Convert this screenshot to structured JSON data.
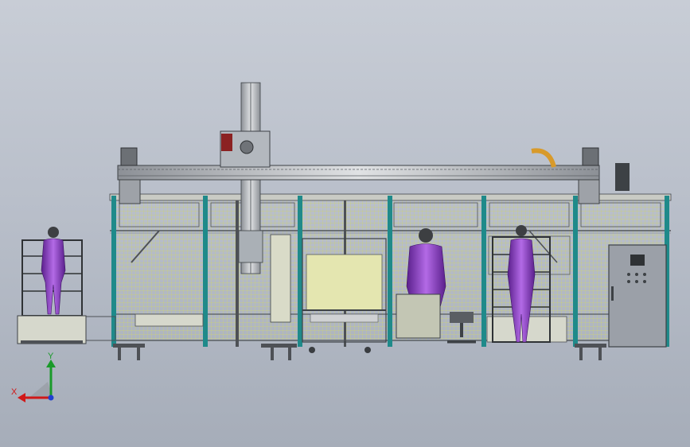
{
  "viewport": {
    "view_name": "Front view",
    "background_top": "#c8cdd6",
    "background_bottom": "#a6adb9"
  },
  "model": {
    "frame_color": "#c9cbc4",
    "frame_dark": "#4e5156",
    "post_accent": "#1f8a8a",
    "mesh_color": "#d7dc6a",
    "mannequin_color": "#8f3fc8",
    "cabinet_color": "#9ba0a8",
    "components": [
      "gantry-beam",
      "vertical-z-axis",
      "guard-enclosure",
      "left-mannequin-fixture",
      "right-mannequin-fixture",
      "operator-mannequin",
      "control-cabinet",
      "office-chair",
      "cart"
    ]
  },
  "triad": {
    "x_label": "X",
    "y_label": "Y",
    "x_color": "#d01818",
    "y_color": "#1a9a2a",
    "z_color": "#2040d0",
    "icon": "coordinate-triad-icon"
  }
}
